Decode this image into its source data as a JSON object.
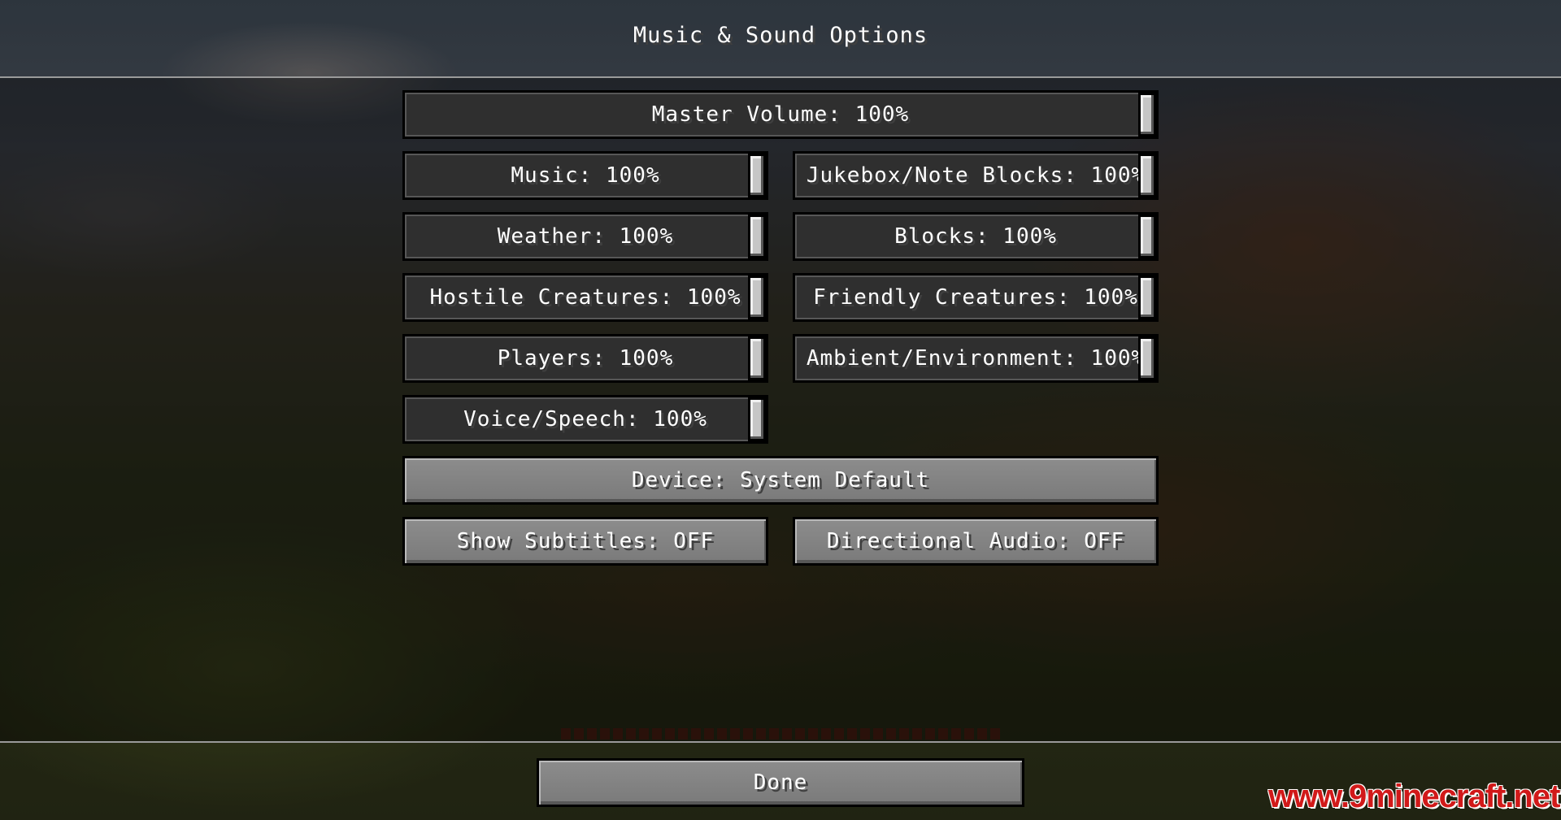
{
  "screen": {
    "title": "Music & Sound Options"
  },
  "sliders": {
    "master": {
      "label": "Master Volume: 100%",
      "value": 1.0
    },
    "music": {
      "label": "Music: 100%",
      "value": 1.0
    },
    "records": {
      "label": "Jukebox/Note Blocks: 100%",
      "value": 1.0
    },
    "weather": {
      "label": "Weather: 100%",
      "value": 1.0
    },
    "blocks": {
      "label": "Blocks: 100%",
      "value": 1.0
    },
    "hostile": {
      "label": "Hostile Creatures: 100%",
      "value": 1.0
    },
    "friendly": {
      "label": "Friendly Creatures: 100%",
      "value": 1.0
    },
    "players": {
      "label": "Players: 100%",
      "value": 1.0
    },
    "ambient": {
      "label": "Ambient/Environment: 100%",
      "value": 1.0
    },
    "voice": {
      "label": "Voice/Speech: 100%",
      "value": 1.0
    }
  },
  "buttons": {
    "device": "Device: System Default",
    "subtitles": "Show Subtitles: OFF",
    "directional": "Directional Audio: OFF",
    "done": "Done"
  },
  "watermark": "www.9minecraft.net"
}
